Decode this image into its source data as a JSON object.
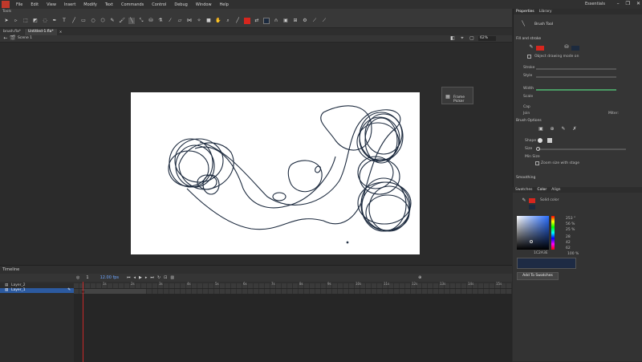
{
  "menubar": {
    "items": [
      "File",
      "Edit",
      "View",
      "Insert",
      "Modify",
      "Text",
      "Commands",
      "Control",
      "Debug",
      "Window",
      "Help"
    ],
    "workspace": "Essentials"
  },
  "tools_panel": {
    "label": "Tools"
  },
  "tabs": [
    {
      "label": "brush.fla*"
    },
    {
      "label": "Untitled-1.fla*"
    }
  ],
  "editbar": {
    "scene": "Scene 1",
    "zoom": "62%"
  },
  "float_panel": {
    "label": "Frame Picker"
  },
  "timeline": {
    "title": "Timeline",
    "fps": "12.00 fps",
    "frame": "1",
    "layers": [
      {
        "name": "Layer_2",
        "selected": false
      },
      {
        "name": "Layer_1",
        "selected": true
      }
    ],
    "ruler_labels": [
      "1s",
      "2s",
      "3s",
      "4s",
      "5s",
      "6s",
      "7s",
      "8s",
      "9s",
      "10s",
      "11s",
      "12s",
      "13s",
      "14s",
      "15s"
    ]
  },
  "properties": {
    "tabs": [
      "Properties",
      "Library"
    ],
    "tool_name": "Brush Tool",
    "section_fill": "Fill and stroke",
    "object_drawing": "Object drawing mode on",
    "labels": [
      "Stroke",
      "Style",
      "Width",
      "Scale",
      "Cap",
      "Join",
      "Miter:"
    ],
    "section_brush": "Brush Options",
    "shape_label": "Shape",
    "size_label": "Size",
    "min_size_label": "Min Size",
    "zoom_stage": "Zoom size with stage",
    "section_smoothing": "Smoothing"
  },
  "color_panel": {
    "tabs": [
      "Swatches",
      "Color",
      "Align"
    ],
    "type": "Solid color",
    "hex": "1C2A3E",
    "values": [
      "253 °",
      "56 %",
      "25 %",
      "28",
      "42",
      "62"
    ],
    "alpha": "100 %",
    "add_swatch": "Add To Swatches"
  },
  "colors": {
    "accent": "#2c5aa0",
    "fill": "#d7261e",
    "stroke": "#1c2a3e"
  }
}
